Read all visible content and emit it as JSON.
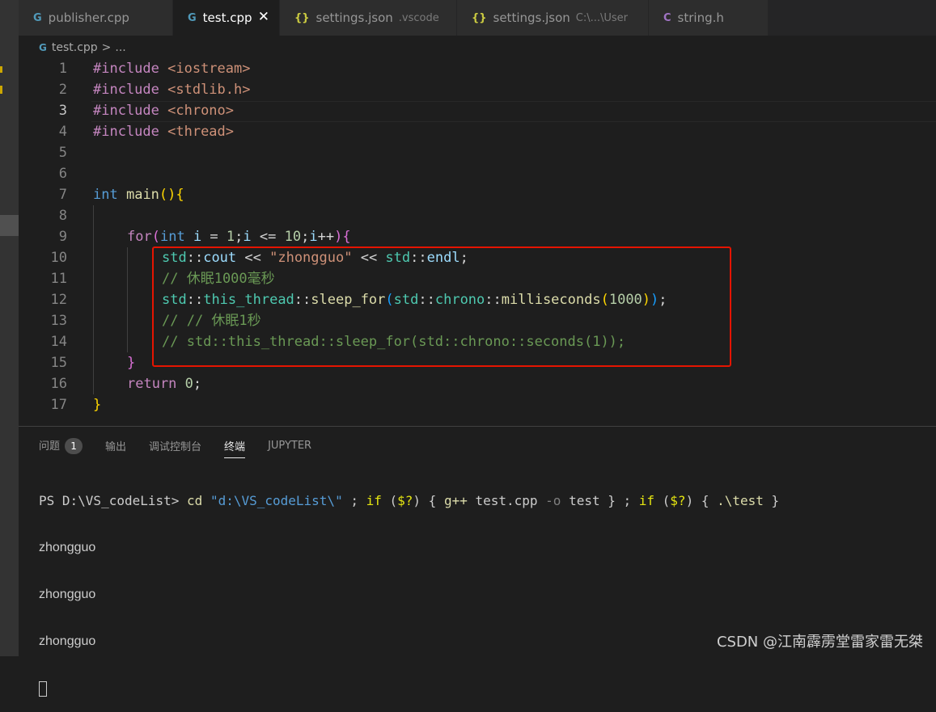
{
  "tabs": [
    {
      "icon": "G",
      "label": "publisher.cpp",
      "desc": ""
    },
    {
      "icon": "G",
      "label": "test.cpp",
      "desc": "",
      "close": "✕"
    },
    {
      "icon": "{}",
      "label": "settings.json",
      "desc": ".vscode"
    },
    {
      "icon": "{}",
      "label": "settings.json",
      "desc": "C:\\...\\User"
    },
    {
      "icon": "C",
      "label": "string.h",
      "desc": ""
    }
  ],
  "breadcrumb": {
    "file": "test.cpp",
    "sep": ">",
    "rest": "..."
  },
  "line_numbers": [
    "1",
    "2",
    "3",
    "4",
    "5",
    "6",
    "7",
    "8",
    "9",
    "10",
    "11",
    "12",
    "13",
    "14",
    "15",
    "16",
    "17"
  ],
  "code": {
    "l1": [
      "#include",
      " <iostream>"
    ],
    "l2": [
      "#include",
      " <stdlib.h>"
    ],
    "l3": [
      "#include",
      " <chrono>"
    ],
    "l4": [
      "#include",
      " <thread>"
    ],
    "l7": [
      "int",
      " ",
      "main",
      "()",
      "{"
    ],
    "l9": [
      "for",
      "(",
      "int",
      " ",
      "i",
      " = ",
      "1",
      ";",
      "i",
      " <= ",
      "10",
      ";",
      "i",
      "++",
      ")",
      "{"
    ],
    "l10": [
      "std",
      "::",
      "cout",
      " << ",
      "\"zhongguo\"",
      " << ",
      "std",
      "::",
      "endl",
      ";"
    ],
    "l11": "// 休眠1000毫秒",
    "l12": [
      "std",
      "::",
      "this_thread",
      "::",
      "sleep_for",
      "(",
      "std",
      "::",
      "chrono",
      "::",
      "milliseconds",
      "(",
      "1000",
      ")",
      ")",
      ";"
    ],
    "l13": "// // 休眠1秒",
    "l14": "// std::this_thread::sleep_for(std::chrono::seconds(1));",
    "l15": "}",
    "l16": [
      "return",
      " ",
      "0",
      ";"
    ],
    "l17": "}"
  },
  "panel": {
    "tabs": [
      "问题",
      "输出",
      "调试控制台",
      "终端",
      "JUPYTER"
    ],
    "problems_count": "1"
  },
  "terminal": {
    "prompt": "PS D:\\VS_codeList> ",
    "cmd": [
      "cd",
      " ",
      "\"d:\\VS_codeList\\\"",
      " ; ",
      "if",
      " (",
      "$?",
      ") { ",
      "g++",
      " test.cpp ",
      "-o",
      " test } ; ",
      "if",
      " (",
      "$?",
      ") { ",
      ".\\test",
      " }"
    ],
    "output": [
      "zhongguo",
      "zhongguo",
      "zhongguo"
    ]
  },
  "watermark": "CSDN @江南霹雳堂雷家雷无桀",
  "colors": {
    "keyword": "#c586c0",
    "type": "#569cd6",
    "function": "#dcdcaa",
    "namespace": "#4ec9b0",
    "number": "#b5cea8",
    "string": "#ce9178",
    "comment": "#6a9955",
    "highlight_box": "#e51400"
  }
}
